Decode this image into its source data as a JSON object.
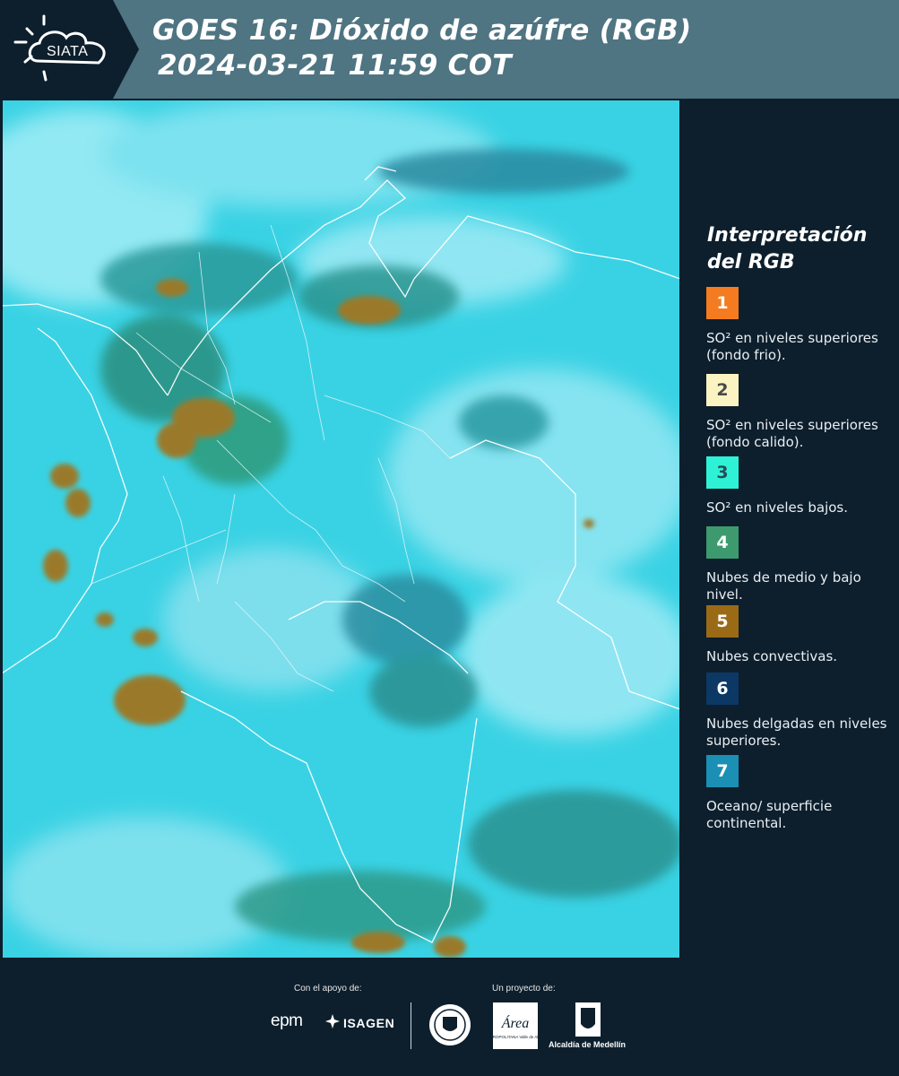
{
  "header": {
    "logo_text": "SIATA",
    "title_line1": "GOES 16: Dióxido de azúfre (RGB)",
    "title_line2": "2024-03-21 11:59 COT"
  },
  "legend": {
    "title": "Interpretación del RGB",
    "items": [
      {
        "number": "1",
        "color": "#f47b20",
        "text_color": "#ffffff",
        "label": "SO² en niveles superiores (fondo frio)."
      },
      {
        "number": "2",
        "color": "#fbf4c2",
        "text_color": "#4a4a4a",
        "label": "SO² en niveles superiores (fondo calido)."
      },
      {
        "number": "3",
        "color": "#2ef2d6",
        "text_color": "#2b4b5a",
        "label": "SO² en niveles bajos."
      },
      {
        "number": "4",
        "color": "#3d9a6e",
        "text_color": "#ffffff",
        "label": "Nubes de medio y bajo nivel."
      },
      {
        "number": "5",
        "color": "#9a6a17",
        "text_color": "#ffffff",
        "label": "Nubes convectivas."
      },
      {
        "number": "6",
        "color": "#0c3866",
        "text_color": "#ffffff",
        "label": "Nubes delgadas en niveles superiores."
      },
      {
        "number": "7",
        "color": "#1b8fb4",
        "text_color": "#ffffff",
        "label": "Oceano/ superficie continental."
      }
    ]
  },
  "footer": {
    "support_label": "Con el apoyo de:",
    "project_label": "Un proyecto de:",
    "sponsors": [
      "epm",
      "ISAGEN"
    ],
    "area_logo_text": "Área",
    "area_logo_subtext": "METROPOLITANA Valle de Aburrá",
    "alcaldia_text": "Alcaldía de Medellín"
  },
  "colors": {
    "header_bg": "#4f7482",
    "panel_bg": "#0d1f2d",
    "sea": "#38d3e6",
    "border_lines": "#ffffff"
  }
}
